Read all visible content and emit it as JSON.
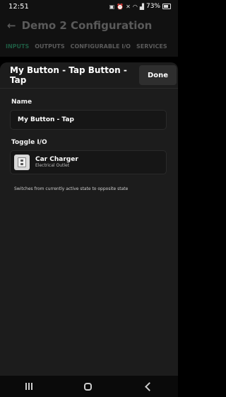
{
  "status_bar": {
    "time": "12:51",
    "battery": "73%"
  },
  "background_screen": {
    "title": "Demo 2 Configuration",
    "tabs": [
      "INPUTS",
      "OUTPUTS",
      "CONFIGURABLE I/O",
      "SERVICES"
    ]
  },
  "sheet": {
    "title": "My Button - Tap Button - Tap",
    "done_label": "Done",
    "name_label": "Name",
    "name_value": "My Button - Tap",
    "toggle_label": "Toggle I/O",
    "io_item": {
      "name": "Car Charger",
      "type": "Electrical Outlet"
    },
    "hint": "Switches from currently active state to opposite state"
  },
  "colors": {
    "accent": "#1e5b42",
    "sheet_bg": "#1c1c1c",
    "field_bg": "#161616"
  }
}
